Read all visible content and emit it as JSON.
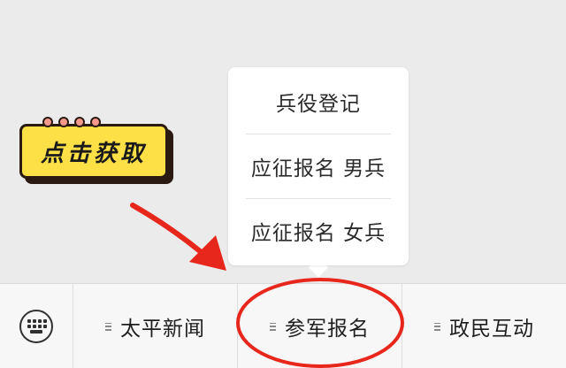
{
  "popup": {
    "items": [
      {
        "label": "兵役登记"
      },
      {
        "label": "应征报名 男兵"
      },
      {
        "label": "应征报名 女兵"
      }
    ]
  },
  "sticker": {
    "text": "点击获取",
    "color": "#fde046"
  },
  "menubar": {
    "keyboard_icon": "keyboard-icon",
    "items": [
      {
        "label": "太平新闻"
      },
      {
        "label": "参军报名"
      },
      {
        "label": "政民互动"
      }
    ]
  },
  "annotation": {
    "color": "#e8271c"
  }
}
